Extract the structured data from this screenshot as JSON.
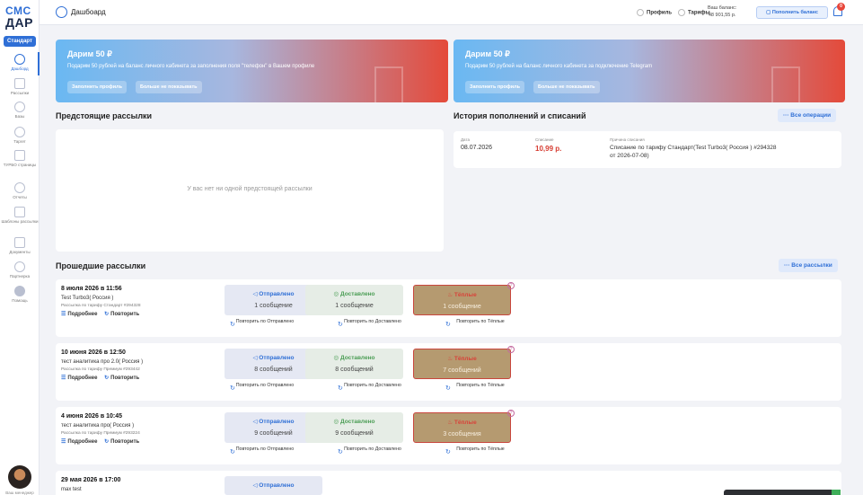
{
  "sidebar": {
    "logo_top": "СМС",
    "logo_bottom": "ДАР",
    "plan": "Стандарт",
    "items": [
      {
        "label": "Дашборд"
      },
      {
        "label": "Рассылки"
      },
      {
        "label": "Базы"
      },
      {
        "label": "Таргет"
      },
      {
        "label": "ТУРБО страницы"
      },
      {
        "label": "Отчеты"
      },
      {
        "label": "Шаблоны рассылки"
      },
      {
        "label": "Документы"
      },
      {
        "label": "Партнерка"
      },
      {
        "label": "Помощь"
      }
    ],
    "user_caption": "Ваш менеджер"
  },
  "header": {
    "title": "Дашбоард",
    "profile": "Профиль",
    "tariffs": "Тарифы",
    "balance_label": "Ваш баланс:",
    "balance_value": "48 901,55 р.",
    "topup": "Пополнить баланс",
    "notifications": "0"
  },
  "promos": [
    {
      "title": "Дарим 50 ₽",
      "text": "Подарим 50 рублей на баланс личного кабинета за заполнения поля \"телефон\" в Вашем профиле",
      "btn1": "Заполнить профиль",
      "btn2": "Больше не показывать"
    },
    {
      "title": "Дарим 50 ₽",
      "text": "Подарим 50 рублей на баланс личного кабинета за подключение Telegram",
      "btn1": "Заполнить профиль",
      "btn2": "Больше не показывать"
    }
  ],
  "upcoming": {
    "title": "Предстоящие рассылки",
    "empty": "У вас нет ни одной предстоящей рассылки"
  },
  "history": {
    "title": "История пополнений и списаний",
    "button": "··· Все операции",
    "col_date": "Дата",
    "col_amount": "Списание",
    "col_reason": "Причина списания",
    "date": "08.07.2026",
    "amount": "10,99 р.",
    "reason": "Списание по тарифу Стандарт(Test Turbo3( Россия ) #294328 от 2026-07-08)"
  },
  "past": {
    "title": "Прошедшие рассылки",
    "button": "··· Все рассылки",
    "details": "Подробнее",
    "repeat": "Повторить",
    "sent_label": "Отправлено",
    "delivered_label": "Доставлено",
    "warm_label": "Тёплые",
    "repeat_sent": "Повторить по Отправлено",
    "repeat_delivered": "Повторить по Доставлено",
    "repeat_warm": "Повторить по Тёплые",
    "items": [
      {
        "date": "8 июля 2026 в 11:56",
        "name": "Test Turbo3( Россия )",
        "tariff": "Рассылка по тарифу Стандарт #294328",
        "sent": "1 сообщение",
        "delivered": "1 сообщение",
        "warm": "1 сообщение"
      },
      {
        "date": "10 июня 2026 в 12:50",
        "name": "тест аналитика про 2.0( Россия )",
        "tariff": "Рассылка по тарифу Премиум #293442",
        "sent": "8 сообщений",
        "delivered": "8 сообщений",
        "warm": "7 сообщений"
      },
      {
        "date": "4 июня 2026 в 10:45",
        "name": "тест аналитика про( Россия )",
        "tariff": "Рассылка по тарифу Премиум #293224",
        "sent": "9 сообщений",
        "delivered": "9 сообщений",
        "warm": "3 сообщения"
      },
      {
        "date": "29 мая 2026 в 17:00",
        "name": "max test"
      }
    ]
  }
}
